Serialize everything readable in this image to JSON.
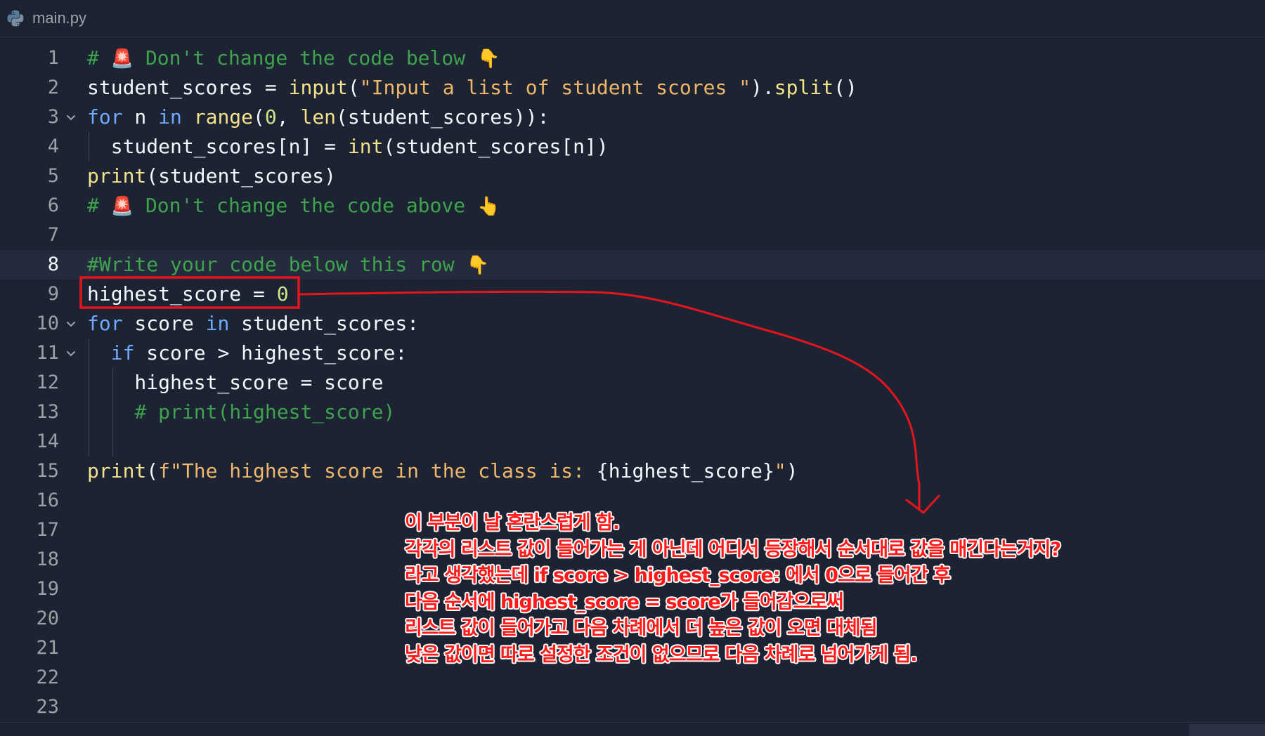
{
  "tab": {
    "filename": "main.py",
    "icon": "python-icon"
  },
  "colors": {
    "background": "#1c2333",
    "comment": "#3fa34d",
    "keyword": "#6fa8ff",
    "function": "#f5e18a",
    "string": "#f0b66a",
    "number": "#cce68a",
    "annotation": "#ff1a1a"
  },
  "editor": {
    "active_line": 8,
    "lines": [
      {
        "n": "1",
        "fold": false,
        "tokens": [
          [
            "cm",
            "# "
          ],
          [
            "emoji",
            "🚨"
          ],
          [
            "cm",
            " Don't change the code below "
          ],
          [
            "emoji",
            "👇"
          ]
        ]
      },
      {
        "n": "2",
        "fold": false,
        "tokens": [
          [
            "txt",
            "student_scores "
          ],
          [
            "op",
            "= "
          ],
          [
            "fn",
            "input"
          ],
          [
            "txt",
            "("
          ],
          [
            "str",
            "\"Input a list of student scores \""
          ],
          [
            "txt",
            ")."
          ],
          [
            "fn",
            "split"
          ],
          [
            "txt",
            "()"
          ]
        ]
      },
      {
        "n": "3",
        "fold": true,
        "tokens": [
          [
            "kw",
            "for"
          ],
          [
            "txt",
            " n "
          ],
          [
            "kw",
            "in"
          ],
          [
            "txt",
            " "
          ],
          [
            "fn",
            "range"
          ],
          [
            "txt",
            "("
          ],
          [
            "num",
            "0"
          ],
          [
            "txt",
            ", "
          ],
          [
            "fn",
            "len"
          ],
          [
            "txt",
            "(student_scores)):"
          ]
        ]
      },
      {
        "n": "4",
        "fold": false,
        "tokens": [
          [
            "txt",
            "  student_scores[n] "
          ],
          [
            "op",
            "= "
          ],
          [
            "fn",
            "int"
          ],
          [
            "txt",
            "(student_scores[n])"
          ]
        ]
      },
      {
        "n": "5",
        "fold": false,
        "tokens": [
          [
            "fn",
            "print"
          ],
          [
            "txt",
            "(student_scores)"
          ]
        ]
      },
      {
        "n": "6",
        "fold": false,
        "tokens": [
          [
            "cm",
            "# "
          ],
          [
            "emoji",
            "🚨"
          ],
          [
            "cm",
            " Don't change the code above "
          ],
          [
            "emoji",
            "👆"
          ]
        ]
      },
      {
        "n": "7",
        "fold": false,
        "tokens": []
      },
      {
        "n": "8",
        "fold": false,
        "tokens": [
          [
            "cm",
            "#Write your code below this row "
          ],
          [
            "emoji",
            "👇"
          ]
        ]
      },
      {
        "n": "9",
        "fold": false,
        "tokens": [
          [
            "txt",
            "highest_score "
          ],
          [
            "op",
            "= "
          ],
          [
            "num",
            "0"
          ]
        ]
      },
      {
        "n": "10",
        "fold": true,
        "tokens": [
          [
            "kw",
            "for"
          ],
          [
            "txt",
            " score "
          ],
          [
            "kw",
            "in"
          ],
          [
            "txt",
            " student_scores:"
          ]
        ]
      },
      {
        "n": "11",
        "fold": true,
        "tokens": [
          [
            "txt",
            "  "
          ],
          [
            "kw",
            "if"
          ],
          [
            "txt",
            " score "
          ],
          [
            "op",
            "> "
          ],
          [
            "txt",
            "highest_score:"
          ]
        ]
      },
      {
        "n": "12",
        "fold": false,
        "tokens": [
          [
            "txt",
            "    highest_score "
          ],
          [
            "op",
            "= "
          ],
          [
            "txt",
            "score"
          ]
        ]
      },
      {
        "n": "13",
        "fold": false,
        "tokens": [
          [
            "txt",
            "    "
          ],
          [
            "cm",
            "# print(highest_score)"
          ]
        ]
      },
      {
        "n": "14",
        "fold": false,
        "tokens": []
      },
      {
        "n": "15",
        "fold": false,
        "tokens": [
          [
            "fn",
            "print"
          ],
          [
            "txt",
            "("
          ],
          [
            "str",
            "f\"The highest score in the class is: "
          ],
          [
            "txt",
            "{highest_score}"
          ],
          [
            "str",
            "\""
          ],
          [
            "txt",
            ")"
          ]
        ]
      },
      {
        "n": "16",
        "fold": false,
        "tokens": []
      },
      {
        "n": "17",
        "fold": false,
        "tokens": []
      },
      {
        "n": "18",
        "fold": false,
        "tokens": []
      },
      {
        "n": "19",
        "fold": false,
        "tokens": []
      },
      {
        "n": "20",
        "fold": false,
        "tokens": []
      },
      {
        "n": "21",
        "fold": false,
        "tokens": []
      },
      {
        "n": "22",
        "fold": false,
        "tokens": []
      },
      {
        "n": "23",
        "fold": false,
        "tokens": []
      }
    ]
  },
  "annotation": {
    "lines": [
      "이 부분이 날 혼란스럽게 함.",
      "각각의 리스트 값이 들어가는 게 아닌데 어디서 등장해서 순서대로 값을 매긴다는거지?",
      "라고 생각했는데 if score > highest_score: 에서 0으로 들어간 후",
      "다음 순서에 highest_score = score가 들어감으로써",
      "리스트 값이 들어가고 다음 차례에서 더 높은 값이 오면 대체됨",
      "낮은 값이면 따로 설정한 조건이 없으므로 다음 차례로 넘어가게 됨."
    ]
  }
}
